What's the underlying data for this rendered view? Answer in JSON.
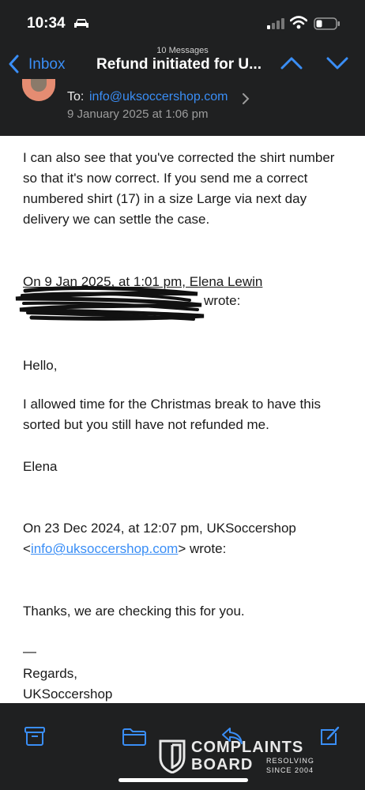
{
  "status_bar": {
    "time": "10:34"
  },
  "nav": {
    "back_label": "Inbox",
    "message_count": "10 Messages",
    "subject": "Refund initiated for U..."
  },
  "header": {
    "to_label": "To:",
    "to_address": "info@uksoccershop.com",
    "date": "9 January 2025 at 1:06 pm"
  },
  "body": {
    "paragraph_1": "I can also see that you've corrected the shirt number so that it's now correct. If you send me a correct numbered shirt (17) in a size Large via next day delivery we can settle the case.",
    "quote_1_line_1": "On 9 Jan 2025, at 1:01 pm, Elena Lewin",
    "quote_1_line_2": "wrote:",
    "greeting": "Hello,",
    "paragraph_2": "I allowed time for the Christmas break to have this sorted but you still have not refunded me.",
    "signature": "Elena",
    "quote_2_line_1": "On 23 Dec 2024, at 12:07 pm, UKSoccershop",
    "quote_2_open": "<",
    "quote_2_email": "info@uksoccershop.com",
    "quote_2_close": "> wrote:",
    "thanks": "Thanks, we are checking this for you.",
    "dash": "—",
    "regards": "Regards,",
    "shop_name": "UKSoccershop"
  },
  "toolbar": {
    "icons": [
      "archive-icon",
      "folder-icon",
      "reply-icon",
      "compose-icon"
    ]
  },
  "watermark": {
    "line_1": "COMPLAINTS",
    "line_2": "BOARD",
    "tag_1": "RESOLVING",
    "tag_2": "SINCE 2004"
  },
  "colors": {
    "chrome_bg": "#1f2021",
    "accent_blue": "#3a8ef6",
    "body_text": "#1a1a1a"
  }
}
